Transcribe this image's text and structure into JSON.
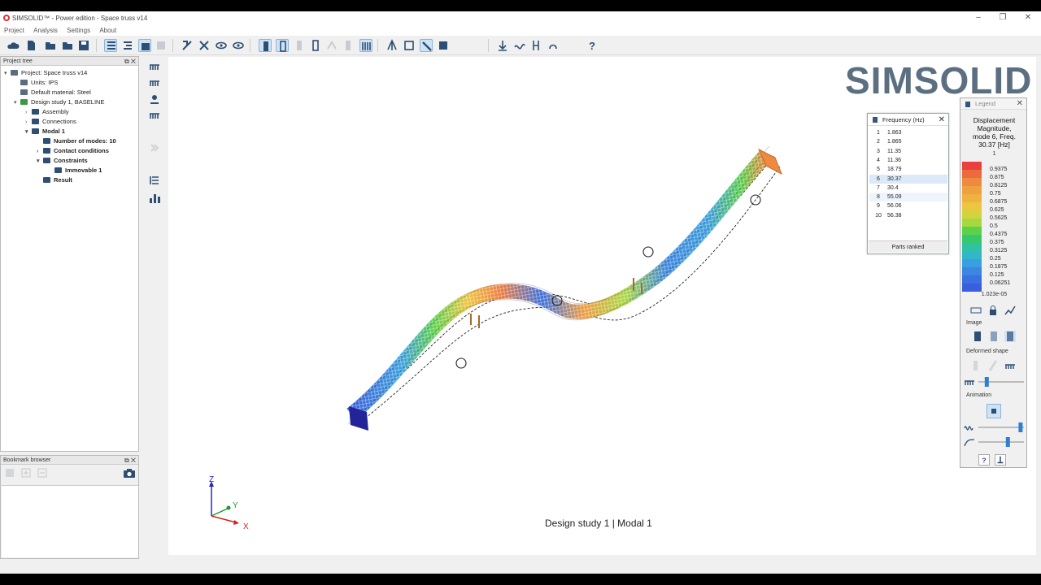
{
  "window": {
    "title": "SIMSOLID™ - Power edition - Space truss v14",
    "min_glyph": "–",
    "max_glyph": "❐",
    "close_glyph": "✕"
  },
  "menu": [
    "Project",
    "Analysis",
    "Settings",
    "About"
  ],
  "project_tree": {
    "header": "Project tree",
    "rows": [
      {
        "label": "Project: Space truss v14",
        "bold": false,
        "arrow": "▾",
        "icon": "project-icon"
      },
      {
        "label": "Units: IPS",
        "bold": false,
        "arrow": "",
        "icon": "units-icon"
      },
      {
        "label": "Default material: Steel",
        "bold": false,
        "arrow": "",
        "icon": "material-icon"
      },
      {
        "label": "Design study 1, BASELINE",
        "bold": false,
        "arrow": "▾",
        "icon": "design-study-icon"
      },
      {
        "label": "Assembly",
        "bold": false,
        "arrow": "›",
        "icon": "assembly-icon"
      },
      {
        "label": "Connections",
        "bold": false,
        "arrow": "›",
        "icon": "connections-icon"
      },
      {
        "label": "Modal 1",
        "bold": true,
        "arrow": "▾",
        "icon": "modal-icon"
      },
      {
        "label": "Number of modes: 10",
        "bold": true,
        "arrow": "",
        "icon": "modes-icon"
      },
      {
        "label": "Contact conditions",
        "bold": true,
        "arrow": "›",
        "icon": "contact-icon"
      },
      {
        "label": "Constraints",
        "bold": true,
        "arrow": "▾",
        "icon": "constraints-icon"
      },
      {
        "label": "Immovable 1",
        "bold": true,
        "arrow": "",
        "icon": "immovable-icon"
      },
      {
        "label": "Result",
        "bold": true,
        "arrow": "",
        "icon": "result-icon"
      }
    ]
  },
  "bookmark": {
    "header": "Bookmark browser"
  },
  "viewport": {
    "logo": "SIMSOLID",
    "caption": "Design study 1 | Modal 1",
    "axes": {
      "z": "Z",
      "y": "Y",
      "x": "X"
    }
  },
  "frequency_panel": {
    "title": "Frequency (Hz)",
    "rows": [
      {
        "n": "1",
        "f": "1.863"
      },
      {
        "n": "2",
        "f": "1.865"
      },
      {
        "n": "3",
        "f": "11.35"
      },
      {
        "n": "4",
        "f": "11.36"
      },
      {
        "n": "5",
        "f": "18.79"
      },
      {
        "n": "6",
        "f": "30.37"
      },
      {
        "n": "7",
        "f": "30.4"
      },
      {
        "n": "8",
        "f": "55.09"
      },
      {
        "n": "9",
        "f": "56.06"
      },
      {
        "n": "10",
        "f": "56.38"
      }
    ],
    "selected_row": 6,
    "hover_row": 8,
    "button": "Parts ranked"
  },
  "legend": {
    "title": "Legend",
    "heading": [
      "Displacement",
      "Magnitude,",
      "mode 6, Freq.",
      "30.37 [Hz]"
    ],
    "max": "1",
    "min": "1.023e-05",
    "entries": [
      {
        "v": "0.9375",
        "c": "#e8413e"
      },
      {
        "v": "0.875",
        "c": "#ec6a3e"
      },
      {
        "v": "0.8125",
        "c": "#ee8a3f"
      },
      {
        "v": "0.75",
        "c": "#efa13f"
      },
      {
        "v": "0.6875",
        "c": "#efb13f"
      },
      {
        "v": "0.625",
        "c": "#eec53f"
      },
      {
        "v": "0.5625",
        "c": "#d2d33f"
      },
      {
        "v": "0.5",
        "c": "#a8d840"
      },
      {
        "v": "0.4375",
        "c": "#5cd24a"
      },
      {
        "v": "0.375",
        "c": "#37c86f"
      },
      {
        "v": "0.3125",
        "c": "#2fc3a3"
      },
      {
        "v": "0.25",
        "c": "#32b7c8"
      },
      {
        "v": "0.1875",
        "c": "#3a9fe0"
      },
      {
        "v": "0.125",
        "c": "#3a86e0"
      },
      {
        "v": "0.06251",
        "c": "#3a70df"
      },
      {
        "v": "",
        "c": "#3a5fdc"
      }
    ],
    "image_label": "Image",
    "deformed_label": "Deformed shape",
    "animation_label": "Animation",
    "deform_level": 0.15,
    "speed_level": 0.95,
    "amplitude_level": 0.65
  },
  "colors": {
    "accent": "#2d7fd3",
    "truss_base": "#23239a"
  }
}
